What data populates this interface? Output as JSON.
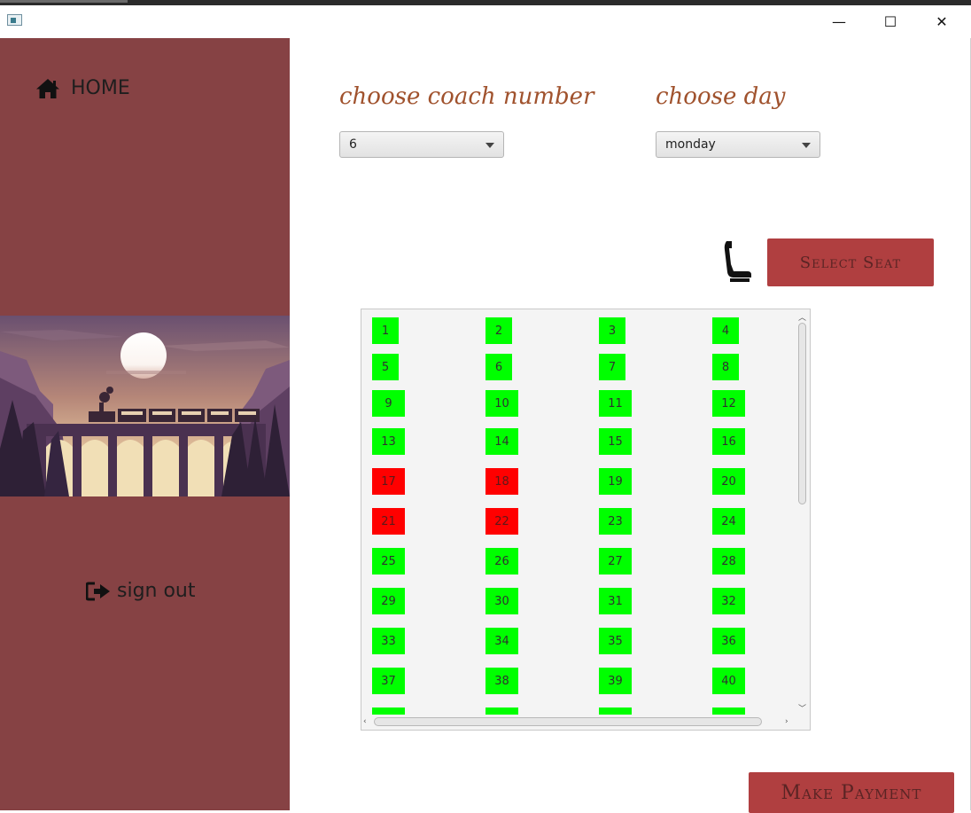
{
  "window": {
    "minimize_glyph": "—",
    "maximize_glyph": "☐",
    "close_glyph": "✕"
  },
  "sidebar": {
    "home_label": "HOME",
    "signout_label": "sign out",
    "home_icon": "house-icon",
    "signout_icon": "sign-out-icon"
  },
  "form": {
    "coach_label": "choose coach number",
    "coach_value": "6",
    "day_label": "choose day",
    "day_value": "monday"
  },
  "actions": {
    "select_seat_label": "Select Seat",
    "make_payment_label": "Make Payment"
  },
  "colors": {
    "sidebar": "#864244",
    "button": "#b03f40",
    "seat_available": "#00ff00",
    "seat_booked": "#ff0000",
    "label_text": "#a0522d"
  },
  "seats": [
    {
      "n": "1",
      "status": "available"
    },
    {
      "n": "2",
      "status": "available"
    },
    {
      "n": "3",
      "status": "available"
    },
    {
      "n": "4",
      "status": "available"
    },
    {
      "n": "5",
      "status": "available"
    },
    {
      "n": "6",
      "status": "available"
    },
    {
      "n": "7",
      "status": "available"
    },
    {
      "n": "8",
      "status": "available"
    },
    {
      "n": "9",
      "status": "available"
    },
    {
      "n": "10",
      "status": "available"
    },
    {
      "n": "11",
      "status": "available"
    },
    {
      "n": "12",
      "status": "available"
    },
    {
      "n": "13",
      "status": "available"
    },
    {
      "n": "14",
      "status": "available"
    },
    {
      "n": "15",
      "status": "available"
    },
    {
      "n": "16",
      "status": "available"
    },
    {
      "n": "17",
      "status": "booked"
    },
    {
      "n": "18",
      "status": "booked"
    },
    {
      "n": "19",
      "status": "available"
    },
    {
      "n": "20",
      "status": "available"
    },
    {
      "n": "21",
      "status": "booked"
    },
    {
      "n": "22",
      "status": "booked"
    },
    {
      "n": "23",
      "status": "available"
    },
    {
      "n": "24",
      "status": "available"
    },
    {
      "n": "25",
      "status": "available"
    },
    {
      "n": "26",
      "status": "available"
    },
    {
      "n": "27",
      "status": "available"
    },
    {
      "n": "28",
      "status": "available"
    },
    {
      "n": "29",
      "status": "available"
    },
    {
      "n": "30",
      "status": "available"
    },
    {
      "n": "31",
      "status": "available"
    },
    {
      "n": "32",
      "status": "available"
    },
    {
      "n": "33",
      "status": "available"
    },
    {
      "n": "34",
      "status": "available"
    },
    {
      "n": "35",
      "status": "available"
    },
    {
      "n": "36",
      "status": "available"
    },
    {
      "n": "37",
      "status": "available"
    },
    {
      "n": "38",
      "status": "available"
    },
    {
      "n": "39",
      "status": "available"
    },
    {
      "n": "40",
      "status": "available"
    },
    {
      "n": "",
      "status": "available"
    },
    {
      "n": "",
      "status": "available"
    },
    {
      "n": "",
      "status": "available"
    },
    {
      "n": "",
      "status": "available"
    }
  ]
}
